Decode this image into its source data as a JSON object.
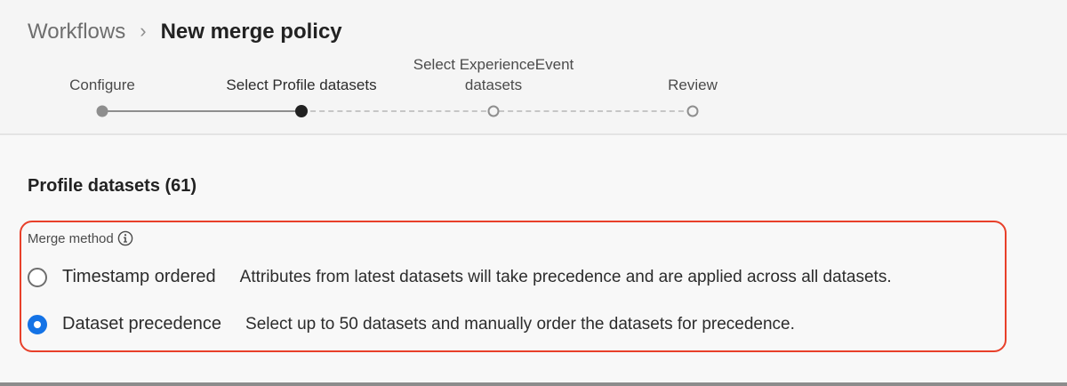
{
  "breadcrumb": {
    "parent": "Workflows",
    "separator": "›",
    "current": "New merge policy"
  },
  "stepper": {
    "steps": [
      {
        "label": "Configure",
        "state": "complete"
      },
      {
        "label": "Select Profile datasets",
        "state": "current"
      },
      {
        "label": "Select ExperienceEvent datasets",
        "state": "upcoming"
      },
      {
        "label": "Review",
        "state": "upcoming"
      }
    ]
  },
  "section": {
    "title": "Profile datasets (61)"
  },
  "merge_method": {
    "label": "Merge method",
    "info_icon": "info-icon",
    "options": [
      {
        "label": "Timestamp ordered",
        "description": "Attributes from latest datasets will take precedence and are applied across all datasets.",
        "selected": false
      },
      {
        "label": "Dataset precedence",
        "description": "Select up to 50 datasets and manually order the datasets for precedence.",
        "selected": true
      }
    ]
  },
  "colors": {
    "accent": "#1473e6",
    "highlight": "#e8402a",
    "step_current": "#222222",
    "step_complete": "#8e8e8e"
  }
}
